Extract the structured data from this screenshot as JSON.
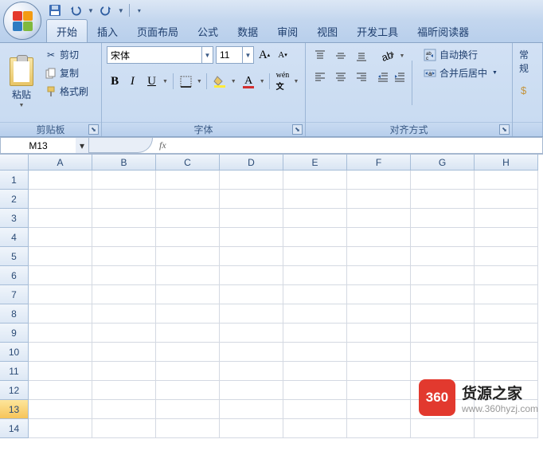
{
  "qat": {
    "save": "保存",
    "undo": "撤销",
    "redo": "重做"
  },
  "tabs": [
    "开始",
    "插入",
    "页面布局",
    "公式",
    "数据",
    "审阅",
    "视图",
    "开发工具",
    "福昕阅读器"
  ],
  "active_tab": 0,
  "clipboard": {
    "paste": "粘贴",
    "cut": "剪切",
    "copy": "复制",
    "painter": "格式刷",
    "group": "剪贴板"
  },
  "font": {
    "name": "宋体",
    "size": "11",
    "group": "字体"
  },
  "align": {
    "wrap": "自动换行",
    "merge": "合并后居中",
    "group": "对齐方式"
  },
  "number": {
    "group_partial": "常规"
  },
  "namebox": "M13",
  "fx": "fx",
  "columns": [
    "A",
    "B",
    "C",
    "D",
    "E",
    "F",
    "G",
    "H"
  ],
  "rows": [
    "1",
    "2",
    "3",
    "4",
    "5",
    "6",
    "7",
    "8",
    "9",
    "10",
    "11",
    "12",
    "13",
    "14"
  ],
  "selected_row": "13",
  "watermark": {
    "badge": "360",
    "title": "货源之家",
    "url": "www.360hyzj.com"
  }
}
